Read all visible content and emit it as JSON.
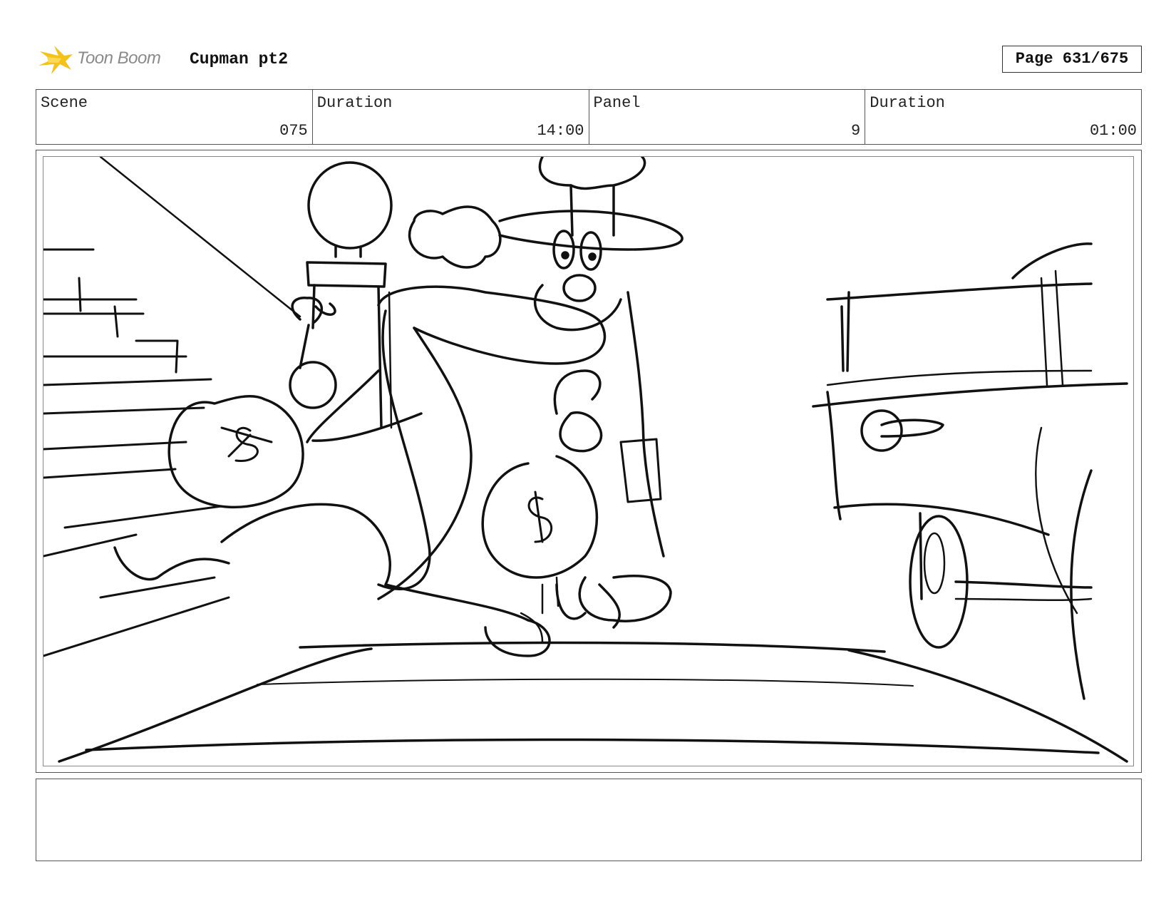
{
  "logo": {
    "text": "Toon Boom",
    "icon": "toon-boom-star-icon",
    "accent_color": "#f5c21b"
  },
  "project": {
    "title": "Cupman pt2"
  },
  "page": {
    "label": "Page 631/675"
  },
  "info": {
    "scene_label": "Scene",
    "scene_value": "075",
    "scene_duration_label": "Duration",
    "scene_duration_value": "14:00",
    "panel_label": "Panel",
    "panel_value": "9",
    "panel_duration_label": "Duration",
    "panel_duration_value": "01:00"
  },
  "notes": {
    "text": ""
  }
}
